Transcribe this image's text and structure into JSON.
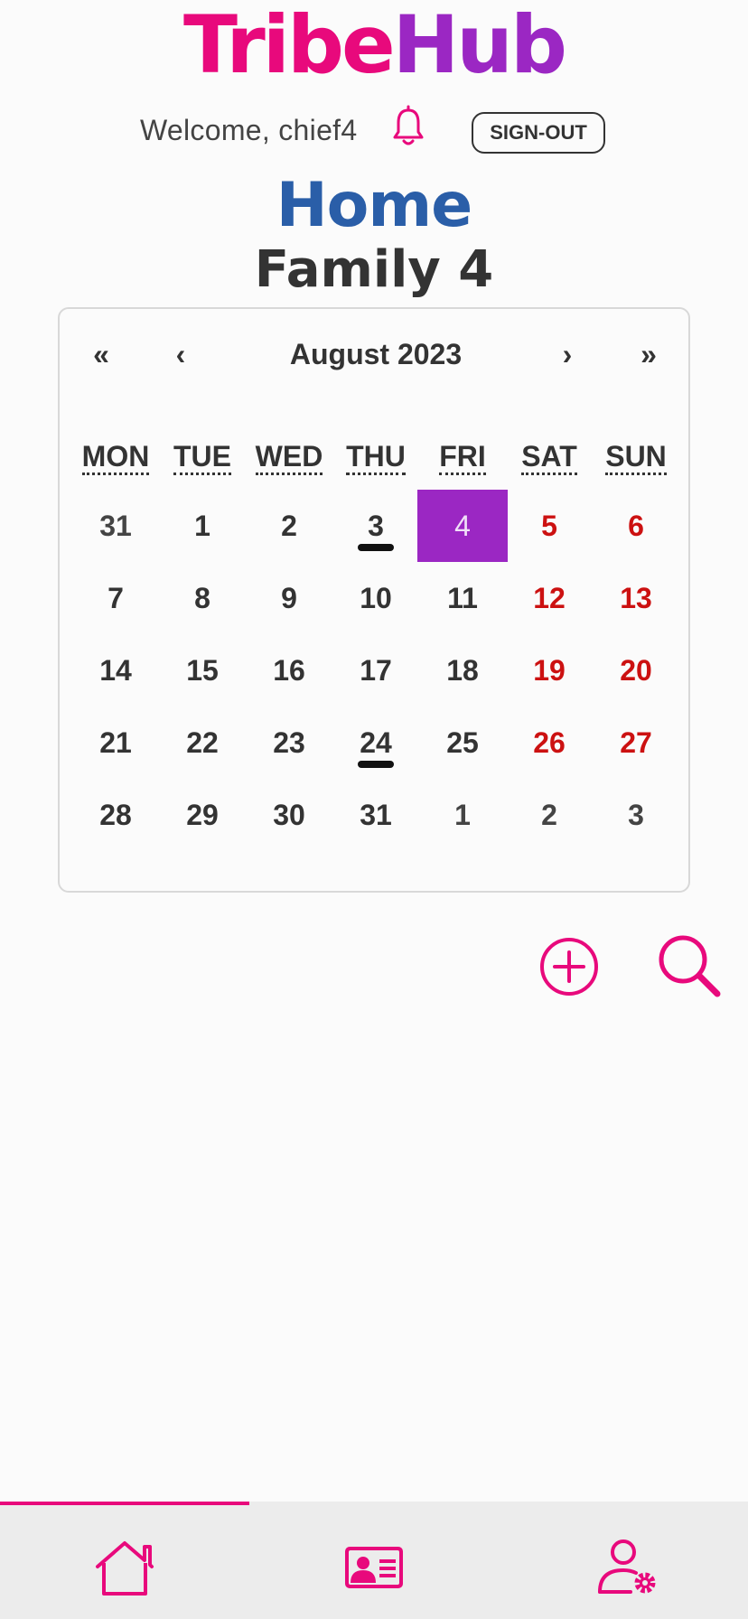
{
  "app": {
    "brand_part1": "Tribe",
    "brand_part2": "Hub",
    "welcome": "Welcome, chief4",
    "signout_label": "SIGN-OUT"
  },
  "header": {
    "title": "Home",
    "family": "Family 4"
  },
  "calendar": {
    "nav": {
      "prev2": "«",
      "prev": "‹",
      "label": "August 2023",
      "next": "›",
      "next2": "»"
    },
    "weekdays": [
      "MON",
      "TUE",
      "WED",
      "THU",
      "FRI",
      "SAT",
      "SUN"
    ],
    "weeks": [
      [
        "31",
        "1",
        "2",
        "3",
        "4",
        "5",
        "6"
      ],
      [
        "7",
        "8",
        "9",
        "10",
        "11",
        "12",
        "13"
      ],
      [
        "14",
        "15",
        "16",
        "17",
        "18",
        "19",
        "20"
      ],
      [
        "21",
        "22",
        "23",
        "24",
        "25",
        "26",
        "27"
      ],
      [
        "28",
        "29",
        "30",
        "31",
        "1",
        "2",
        "3"
      ]
    ],
    "selected_date": "4",
    "event_dates": [
      "3",
      "24"
    ]
  },
  "actions": {
    "add_icon": "plus-circle-icon",
    "search_icon": "search-icon"
  },
  "bottom_nav": {
    "items": [
      {
        "icon": "home-icon",
        "active": true
      },
      {
        "icon": "contact-card-icon",
        "active": false
      },
      {
        "icon": "user-settings-icon",
        "active": false
      }
    ]
  },
  "colors": {
    "brand_pink": "#e8097c",
    "brand_purple": "#9b27c3",
    "title_blue": "#2a5ea8",
    "weekend_red": "#cc1111"
  }
}
